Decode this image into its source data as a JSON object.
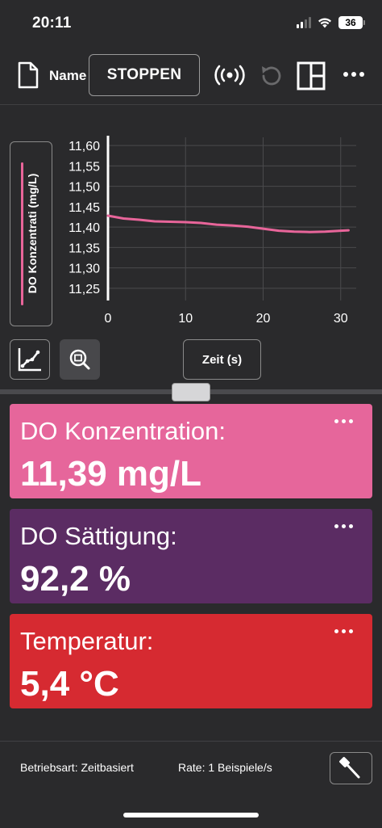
{
  "status_bar": {
    "time": "20:11",
    "battery": "36"
  },
  "toolbar": {
    "name_label": "Name",
    "stop_label": "STOPPEN"
  },
  "graph": {
    "y_axis_button": "DO Konzentrati (mg/L)",
    "x_axis_button": "Zeit (s)"
  },
  "chart_data": {
    "type": "line",
    "xlabel": "Zeit (s)",
    "ylabel": "DO Konzentrati (mg/L)",
    "xlim": [
      0,
      32
    ],
    "ylim": [
      11.22,
      11.62
    ],
    "x_ticks": [
      "0",
      "10",
      "20",
      "30"
    ],
    "x_tick_values": [
      0,
      10,
      20,
      30
    ],
    "y_ticks": [
      "11,60",
      "11,55",
      "11,50",
      "11,45",
      "11,40",
      "11,35",
      "11,30",
      "11,25"
    ],
    "y_tick_values": [
      11.6,
      11.55,
      11.5,
      11.45,
      11.4,
      11.35,
      11.3,
      11.25
    ],
    "grid": true,
    "series": [
      {
        "color": "#e8659a",
        "x": [
          0,
          2,
          4,
          6,
          8,
          10,
          12,
          14,
          16,
          18,
          20,
          22,
          24,
          26,
          28,
          30,
          31
        ],
        "y": [
          11.428,
          11.421,
          11.418,
          11.414,
          11.413,
          11.412,
          11.41,
          11.406,
          11.404,
          11.401,
          11.396,
          11.391,
          11.389,
          11.388,
          11.389,
          11.391,
          11.392
        ]
      }
    ]
  },
  "meters": [
    {
      "label": "DO Konzentration:",
      "value": "11,39 mg/L",
      "color": "#e6669b"
    },
    {
      "label": "DO Sättigung:",
      "value": "92,2 %",
      "color": "#5b2c63"
    },
    {
      "label": "Temperatur:",
      "value": "5,4 °C",
      "color": "#d62a31"
    }
  ],
  "footer": {
    "mode": "Betriebsart: Zeitbasiert",
    "rate": "Rate: 1 Beispiele/s"
  },
  "icons": [
    "document-icon",
    "broadcast-icon",
    "undo-icon",
    "layout-icon",
    "more-icon",
    "graph-options-icon",
    "zoom-icon",
    "more-icon",
    "tool-icon"
  ]
}
